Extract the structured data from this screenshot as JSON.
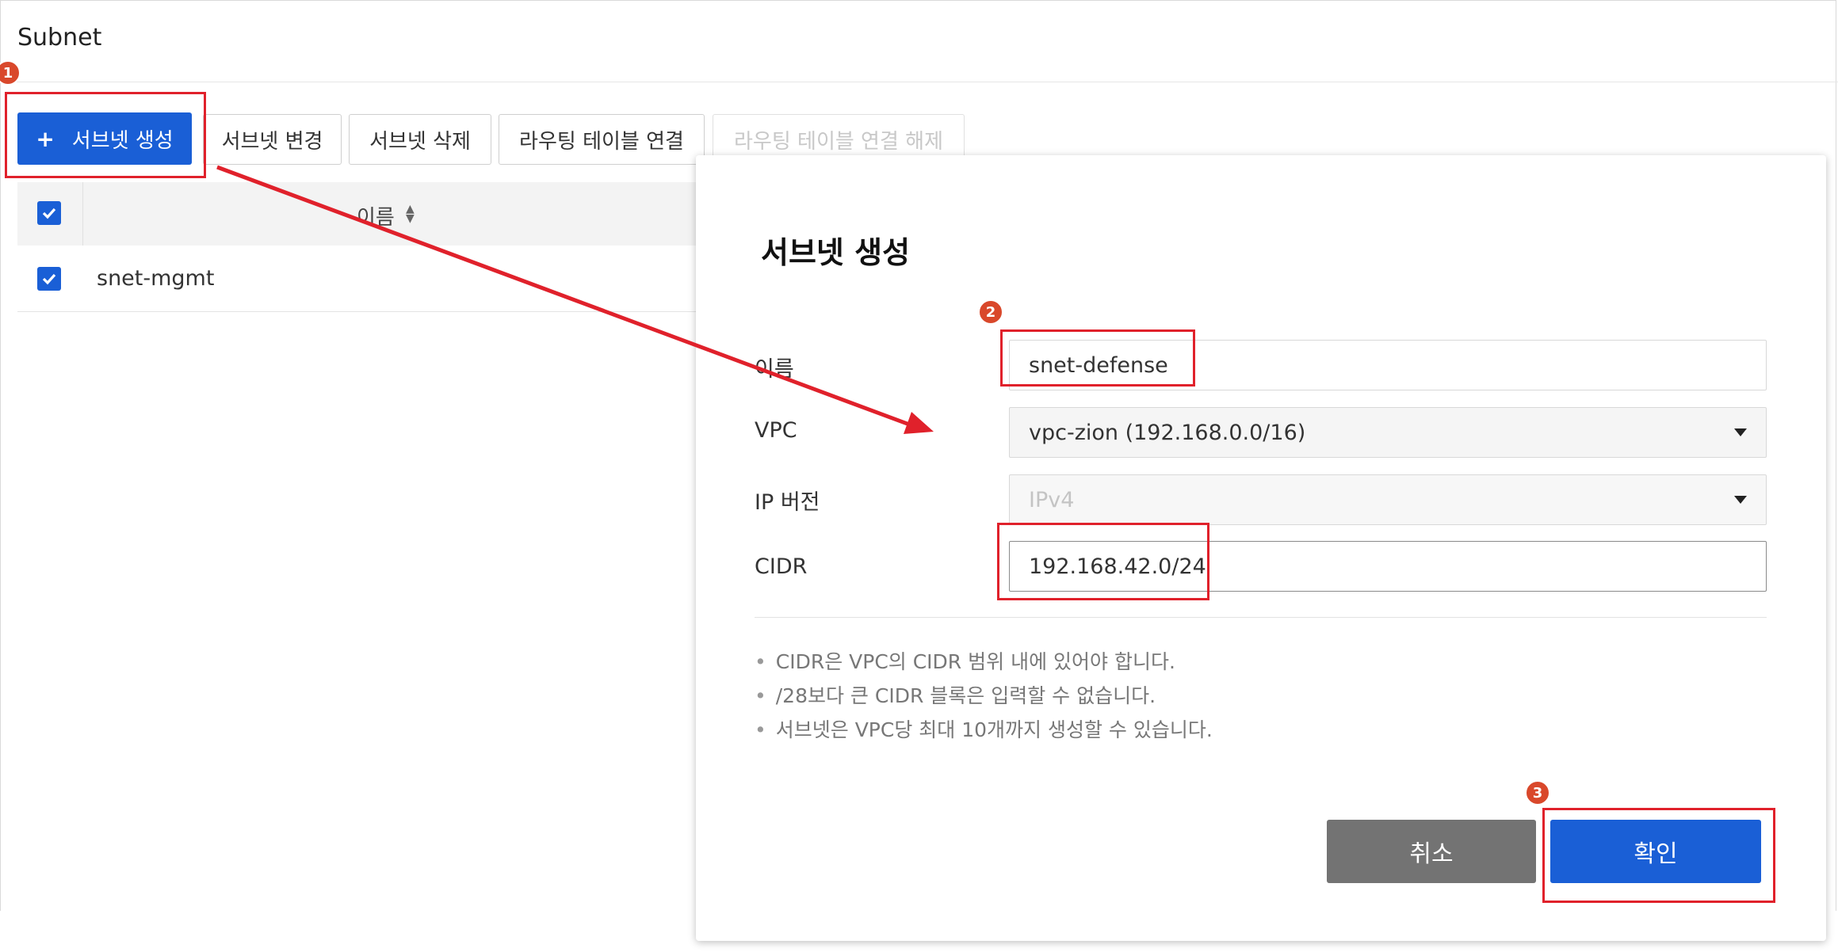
{
  "page": {
    "title": "Subnet"
  },
  "toolbar": {
    "create": "서브넷 생성",
    "edit": "서브넷 변경",
    "delete": "서브넷 삭제",
    "route_attach": "라우팅 테이블 연결",
    "route_detach": "라우팅 테이블 연결 해제"
  },
  "table": {
    "columns": {
      "name": "이름"
    },
    "rows": [
      {
        "name": "snet-mgmt",
        "checked": true
      }
    ],
    "select_all_checked": true
  },
  "modal": {
    "title": "서브넷 생성",
    "fields": {
      "name_label": "이름",
      "name_value": "snet-defense",
      "vpc_label": "VPC",
      "vpc_value": "vpc-zion (192.168.0.0/16)",
      "ipver_label": "IP 버전",
      "ipver_value": "IPv4",
      "cidr_label": "CIDR",
      "cidr_value": "192.168.42.0/24"
    },
    "notes": [
      "CIDR은 VPC의 CIDR 범위 내에 있어야 합니다.",
      "/28보다 큰 CIDR 블록은 입력할 수 없습니다.",
      "서브넷은 VPC당 최대 10개까지 생성할 수 있습니다."
    ],
    "cancel": "취소",
    "confirm": "확인"
  },
  "annotations": {
    "step1": "1",
    "step2": "2",
    "step3": "3"
  },
  "colors": {
    "primary": "#1a5fd6",
    "annotation": "#e0212b",
    "badge": "#d9482b",
    "cancel": "#737373"
  }
}
